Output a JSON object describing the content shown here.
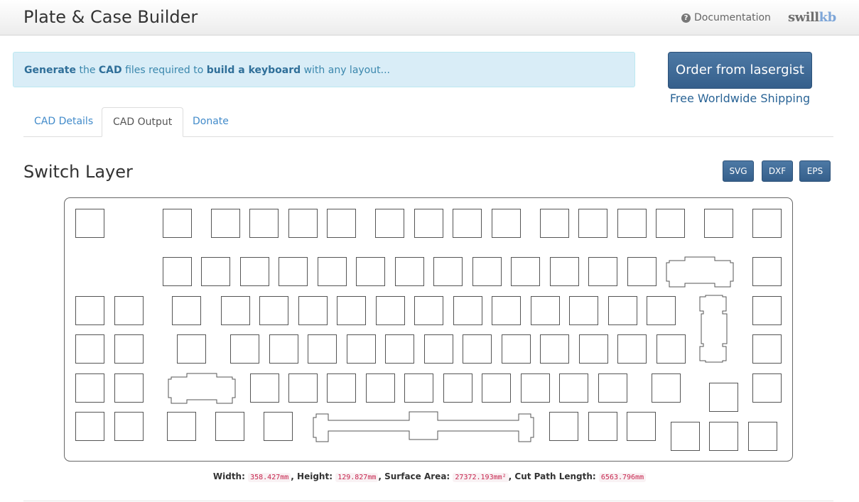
{
  "header": {
    "title": "Plate & Case Builder",
    "doc_link": "Documentation",
    "help_icon": "question-circle-icon",
    "brand_part1": "swill",
    "brand_part2": "kb"
  },
  "alert": {
    "w1": "Generate",
    "t1": " the ",
    "w2": "CAD",
    "t2": " files required to ",
    "w3": "build a keyboard",
    "t3": " with any layout..."
  },
  "order": {
    "button_label": "Order from lasergist",
    "shipping_label": "Free Worldwide Shipping"
  },
  "tabs": [
    {
      "label": "CAD Details",
      "active": false
    },
    {
      "label": "CAD Output",
      "active": true
    },
    {
      "label": "Donate",
      "active": false
    }
  ],
  "section": {
    "title": "Switch Layer",
    "buttons": [
      "SVG",
      "DXF",
      "EPS"
    ]
  },
  "stats": {
    "width_label": "Width:",
    "width_value": "358.427mm",
    "height_label": "Height:",
    "height_value": "129.827mm",
    "area_label": "Surface Area:",
    "area_value": "27372.193mm²",
    "cut_label": "Cut Path Length:",
    "cut_value": "6563.796mm"
  },
  "colors": {
    "accent": "#3d6a99",
    "alert_bg": "#d9edf7",
    "link": "#428bca",
    "code": "#c7254e"
  }
}
